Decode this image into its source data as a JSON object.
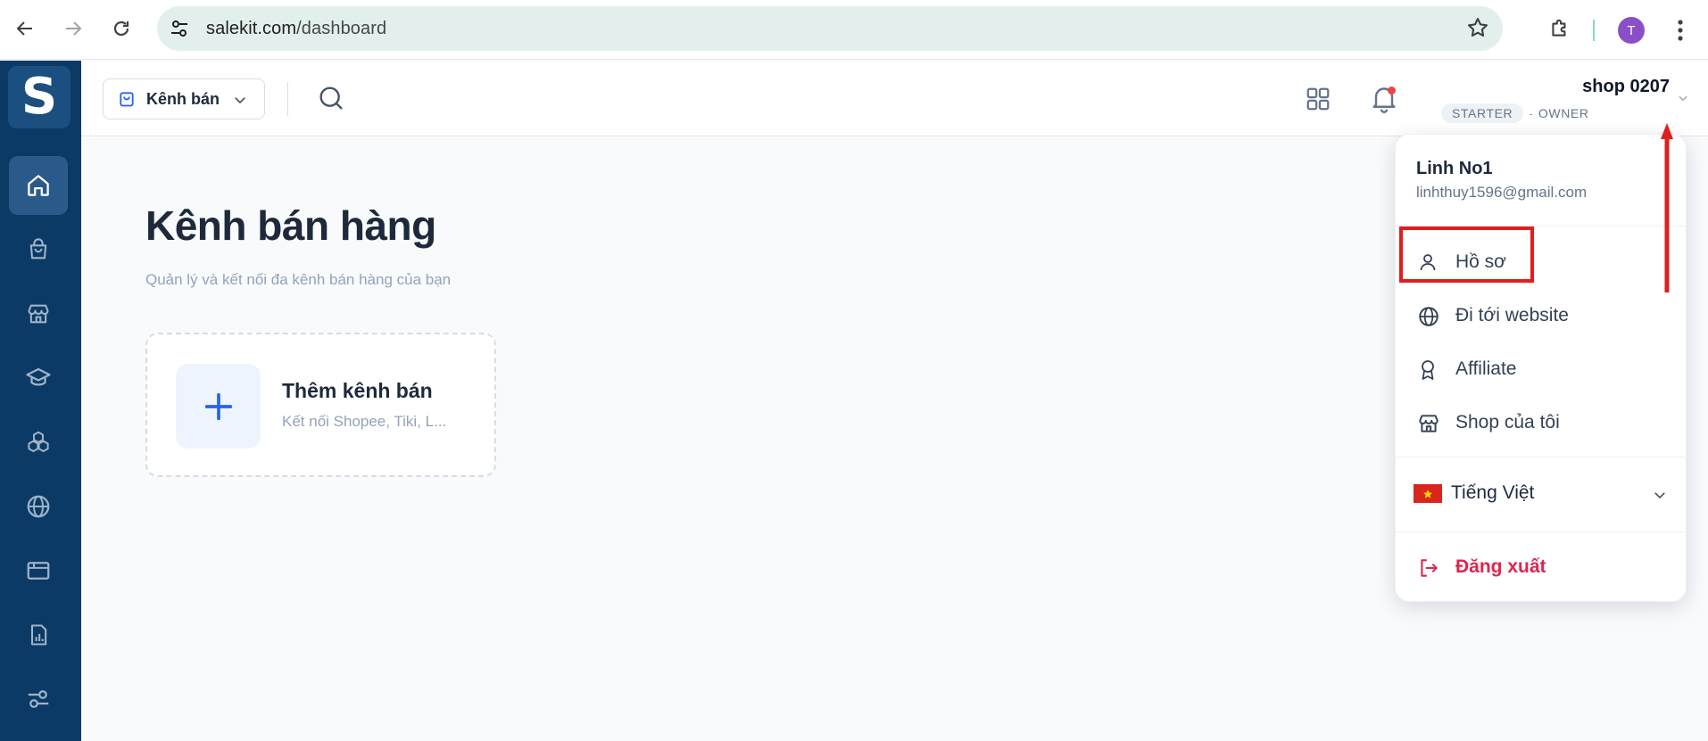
{
  "browser": {
    "url_domain": "salekit.com",
    "url_path": "/dashboard",
    "profile_initial": "T"
  },
  "sidebar": {
    "logo_letter": "S",
    "items": [
      {
        "icon": "home-icon",
        "active": true
      },
      {
        "icon": "shopping-bag-icon",
        "active": false
      },
      {
        "icon": "store-icon",
        "active": false
      },
      {
        "icon": "graduation-cap-icon",
        "active": false
      },
      {
        "icon": "cubes-icon",
        "active": false
      },
      {
        "icon": "globe-icon",
        "active": false
      },
      {
        "icon": "browser-window-icon",
        "active": false
      },
      {
        "icon": "report-chart-icon",
        "active": false
      },
      {
        "icon": "settings-sliders-icon",
        "active": false
      }
    ]
  },
  "header": {
    "channel_label": "Kênh bán",
    "shop_name": "shop 0207",
    "plan": "STARTER",
    "meta_separator": "-",
    "role": "OWNER"
  },
  "main": {
    "title": "Kênh bán hàng",
    "subtitle": "Quản lý và kết nối đa kênh bán hàng của bạn",
    "add_card": {
      "title": "Thêm kênh bán",
      "description": "Kết nối Shopee, Tiki, L..."
    }
  },
  "dropdown": {
    "user_name": "Linh No1",
    "email": "linhthuy1596@gmail.com",
    "items": [
      {
        "label": "Hồ sơ",
        "icon": "user-icon"
      },
      {
        "label": "Đi tới website",
        "icon": "globe-icon"
      },
      {
        "label": "Affiliate",
        "icon": "award-icon"
      },
      {
        "label": "Shop của tôi",
        "icon": "store-icon"
      }
    ],
    "language": "Tiếng Việt",
    "logout": "Đăng xuất"
  },
  "colors": {
    "sidebar_bg": "#0b3a66",
    "accent_blue": "#2563eb",
    "logout_red": "#dc2650",
    "annotation_red": "#e11d1d"
  }
}
